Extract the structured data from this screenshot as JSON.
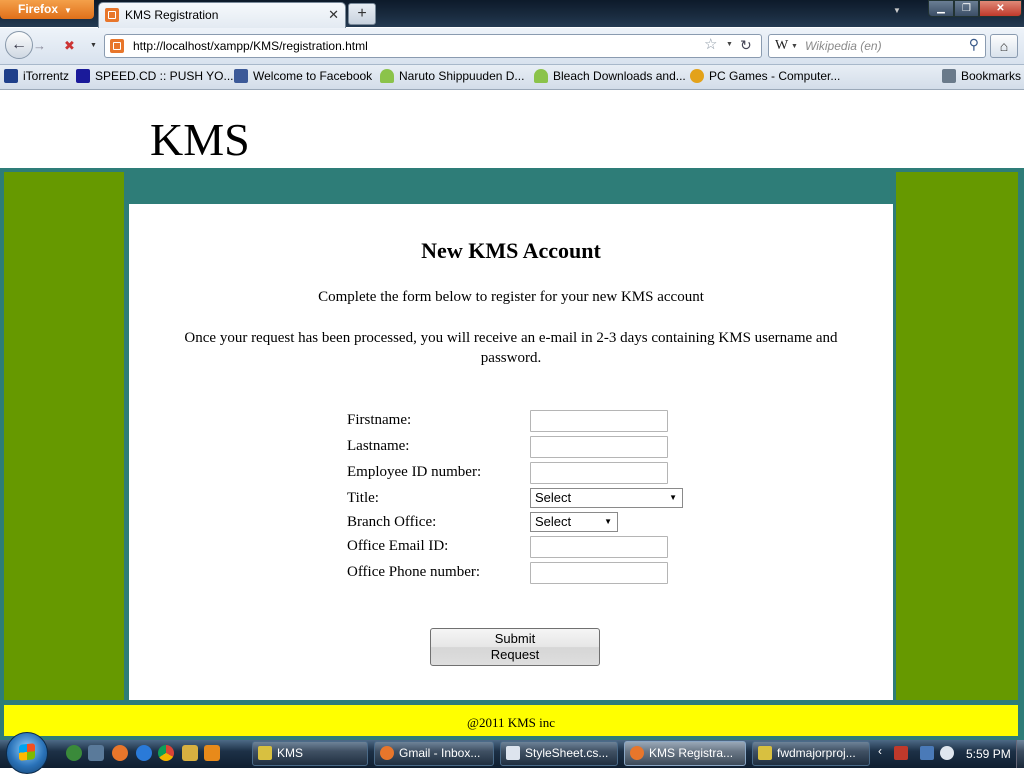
{
  "browser": {
    "app_button": "Firefox",
    "tab_title": "KMS Registration",
    "new_tab_symbol": "+",
    "url": "http://localhost/xampp/KMS/registration.html",
    "search_engine_letter": "W",
    "search_placeholder": "Wikipedia (en)",
    "bookmarks": [
      {
        "label": "iTorrentz",
        "icon": "torrentz-icon"
      },
      {
        "label": "SPEED.CD :: PUSH YO...",
        "icon": "speedcd-icon"
      },
      {
        "label": "Welcome to Facebook",
        "icon": "facebook-icon"
      },
      {
        "label": "Naruto Shippuuden D...",
        "icon": "android-icon"
      },
      {
        "label": "Bleach Downloads and...",
        "icon": "android-icon"
      },
      {
        "label": "PC Games - Computer...",
        "icon": "gamespot-icon"
      }
    ],
    "bookmarks_menu": "Bookmarks"
  },
  "page": {
    "logo": "KMS",
    "heading": "New KMS Account",
    "intro1": "Complete the form below to register for your new KMS account",
    "intro2": "Once your request has been processed, you will receive an e-mail in 2-3 days containing KMS username and password.",
    "form": {
      "firstname_label": "Firstname:",
      "lastname_label": "Lastname:",
      "employee_id_label": "Employee ID number:",
      "title_label": "Title:",
      "title_selected": "Select",
      "branch_label": "Branch Office:",
      "branch_selected": "Select",
      "email_label": "Office Email ID:",
      "phone_label": "Office Phone number:",
      "submit_line1": "Submit",
      "submit_line2": "Request"
    },
    "footer": "@2011 KMS inc"
  },
  "taskbar": {
    "tasks": [
      {
        "label": "KMS"
      },
      {
        "label": "Gmail - Inbox..."
      },
      {
        "label": "StyleSheet.cs..."
      },
      {
        "label": "KMS Registra..."
      },
      {
        "label": "fwdmajorproj..."
      }
    ],
    "clock": "5:59 PM"
  },
  "colors": {
    "frame_teal": "#2e7d78",
    "side_green": "#669900",
    "footer_yellow": "#ffff00"
  }
}
